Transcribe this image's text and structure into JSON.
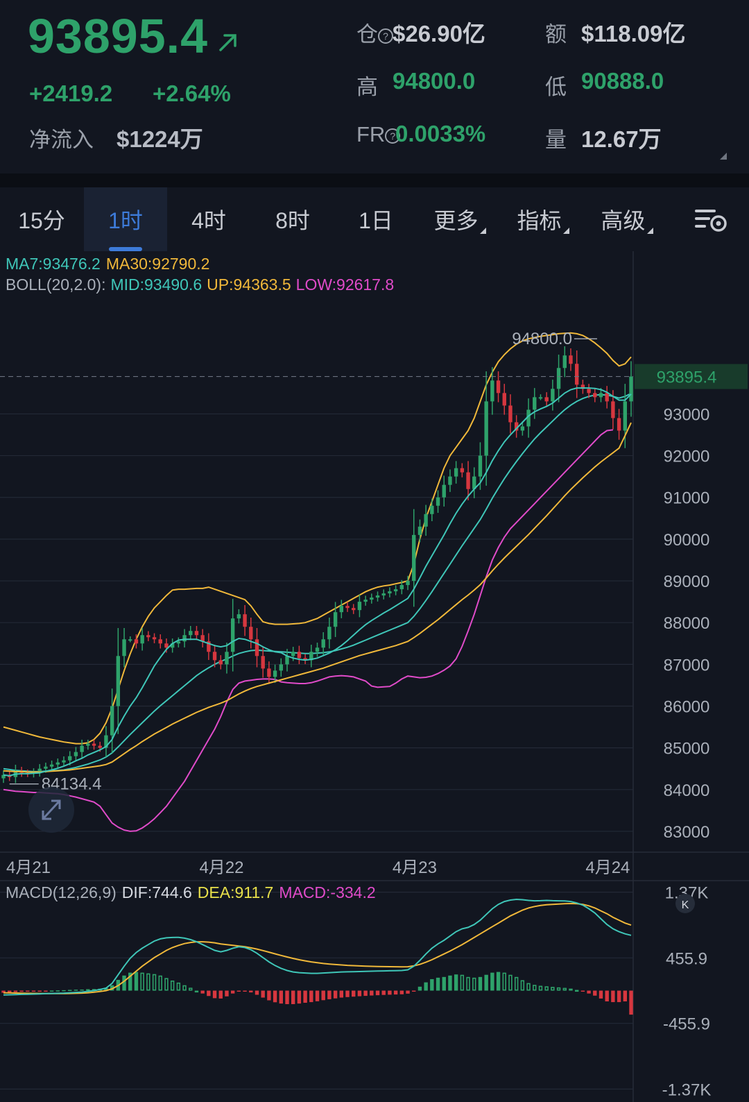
{
  "header": {
    "price": "93895.4",
    "change_abs": "+2419.2",
    "change_pct": "+2.64%",
    "netflow_label": "净流入",
    "netflow_value": "$1224万",
    "oi_label": "仓",
    "oi_value": "$26.90亿",
    "amount_label": "额",
    "amount_value": "$118.09亿",
    "high_label": "高",
    "high_value": "94800.0",
    "low_label": "低",
    "low_value": "90888.0",
    "fr_label": "FR",
    "fr_value": "0.0033%",
    "volume_label": "量",
    "volume_value": "12.67万",
    "info_glyph": "?"
  },
  "tabs": [
    {
      "label": "15分",
      "active": false
    },
    {
      "label": "1时",
      "active": true
    },
    {
      "label": "4时",
      "active": false
    },
    {
      "label": "8时",
      "active": false
    },
    {
      "label": "1日",
      "active": false
    },
    {
      "label": "更多",
      "active": false,
      "dropdown": true
    },
    {
      "label": "指标",
      "active": false,
      "dropdown": true
    },
    {
      "label": "高级",
      "active": false,
      "dropdown": true
    }
  ],
  "icons": {
    "price_arrow": "arrow-up-right-icon",
    "settings": "chart-settings-icon",
    "expand": "expand-icon",
    "collapse": "collapse-icon",
    "info": "question-circle-icon"
  },
  "colors": {
    "up": "#2ea26a",
    "down": "#d6373f",
    "ma7": "#3fc6b8",
    "ma30": "#f0b83a",
    "boll_mid": "#3fc6b8",
    "boll_up": "#f0b83a",
    "boll_low": "#e04bc9",
    "dif": "#3fc6b8",
    "dea": "#f0b83a",
    "accent": "#3d7bd9"
  },
  "chart_data": [
    {
      "type": "candlestick",
      "legend": {
        "ma7_text": "MA7:93476.2",
        "ma30_text": "MA30:92790.2",
        "boll_prefix": "BOLL(20,2.0):",
        "boll_mid_text": "MID:93490.6",
        "boll_up_text": "UP:94363.5",
        "boll_low_text": "LOW:92617.8"
      },
      "x_labels": [
        "4月21",
        "4月22",
        "4月23",
        "4月24"
      ],
      "y_ticks": [
        93000,
        92000,
        91000,
        90000,
        89000,
        88000,
        87000,
        86000,
        85000,
        84000,
        83000
      ],
      "ylim": [
        82600,
        95900
      ],
      "last_price_label": "93895.4",
      "max_label": "94800.0",
      "min_label": "84134.4",
      "grid": true,
      "closes": [
        84350,
        84300,
        84450,
        84400,
        84380,
        84420,
        84500,
        84550,
        84600,
        84650,
        84700,
        84800,
        84900,
        85050,
        85100,
        85050,
        85000,
        85300,
        86000,
        87200,
        87600,
        87600,
        87500,
        87700,
        87650,
        87600,
        87500,
        87400,
        87500,
        87550,
        87700,
        87800,
        87700,
        87550,
        87300,
        87100,
        87000,
        87300,
        88100,
        88200,
        87900,
        87600,
        87200,
        86900,
        86700,
        86850,
        87000,
        87200,
        87300,
        87150,
        87100,
        87300,
        87400,
        87600,
        87900,
        88250,
        88400,
        88350,
        88300,
        88500,
        88550,
        88600,
        88650,
        88700,
        88750,
        88800,
        88900,
        89000,
        90100,
        90300,
        90600,
        90800,
        91000,
        91300,
        91500,
        91700,
        91600,
        91200,
        91500,
        92000,
        93300,
        93800,
        93500,
        93200,
        92800,
        92600,
        92700,
        93100,
        93400,
        93400,
        93300,
        93600,
        94100,
        94400,
        94200,
        93700,
        93600,
        93500,
        93400,
        93500,
        93300,
        92900,
        92600,
        93300,
        93895.4
      ],
      "ma7": [
        84350,
        84330,
        84370,
        84380,
        84380,
        84390,
        84400,
        84440,
        84470,
        84510,
        84560,
        84620,
        84690,
        84750,
        84830,
        84890,
        84950,
        85030,
        85200,
        85500,
        85760,
        86000,
        86200,
        86440,
        86700,
        86960,
        87170,
        87360,
        87500,
        87580,
        87600,
        87600,
        87600,
        87550,
        87500,
        87450,
        87420,
        87450,
        87550,
        87620,
        87600,
        87550,
        87500,
        87420,
        87350,
        87300,
        87280,
        87200,
        87150,
        87120,
        87100,
        87120,
        87150,
        87210,
        87270,
        87350,
        87450,
        87570,
        87700,
        87830,
        87950,
        88050,
        88140,
        88230,
        88310,
        88400,
        88490,
        88580,
        88800,
        89070,
        89350,
        89600,
        89850,
        90100,
        90370,
        90620,
        90840,
        91030,
        91200,
        91350,
        91600,
        91880,
        92120,
        92330,
        92500,
        92650,
        92800,
        92950,
        93050,
        93120,
        93180,
        93260,
        93380,
        93500,
        93580,
        93620,
        93620,
        93620,
        93610,
        93580,
        93520,
        93420,
        93330,
        93330,
        93476.2
      ],
      "ma30": [
        84450,
        84440,
        84430,
        84430,
        84420,
        84420,
        84420,
        84430,
        84440,
        84450,
        84460,
        84470,
        84490,
        84510,
        84530,
        84550,
        84570,
        84600,
        84660,
        84760,
        84860,
        84960,
        85050,
        85150,
        85240,
        85330,
        85410,
        85490,
        85570,
        85640,
        85710,
        85780,
        85850,
        85910,
        85970,
        86020,
        86070,
        86130,
        86210,
        86290,
        86360,
        86420,
        86470,
        86510,
        86550,
        86590,
        86630,
        86670,
        86710,
        86750,
        86790,
        86830,
        86870,
        86910,
        86960,
        87010,
        87060,
        87110,
        87160,
        87210,
        87250,
        87290,
        87330,
        87370,
        87410,
        87450,
        87500,
        87550,
        87640,
        87740,
        87850,
        87960,
        88070,
        88190,
        88310,
        88430,
        88550,
        88660,
        88780,
        88910,
        89070,
        89240,
        89400,
        89550,
        89690,
        89830,
        89970,
        90110,
        90260,
        90410,
        90560,
        90720,
        90880,
        91040,
        91190,
        91330,
        91470,
        91600,
        91730,
        91850,
        91960,
        92070,
        92180,
        92480,
        92790.2
      ],
      "boll_mid": [
        84500,
        84480,
        84460,
        84450,
        84440,
        84430,
        84430,
        84440,
        84450,
        84460,
        84470,
        84500,
        84530,
        84570,
        84610,
        84660,
        84710,
        84780,
        84880,
        85020,
        85170,
        85320,
        85460,
        85600,
        85740,
        85880,
        86010,
        86130,
        86250,
        86370,
        86490,
        86610,
        86730,
        86830,
        86920,
        87000,
        87070,
        87130,
        87200,
        87260,
        87300,
        87330,
        87340,
        87330,
        87320,
        87310,
        87300,
        87290,
        87280,
        87270,
        87260,
        87260,
        87270,
        87280,
        87300,
        87330,
        87370,
        87410,
        87460,
        87520,
        87580,
        87640,
        87700,
        87760,
        87820,
        87880,
        87940,
        88000,
        88150,
        88330,
        88530,
        88740,
        88960,
        89180,
        89400,
        89620,
        89840,
        90050,
        90260,
        90470,
        90720,
        90980,
        91220,
        91450,
        91660,
        91860,
        92050,
        92230,
        92400,
        92550,
        92690,
        92830,
        92970,
        93100,
        93210,
        93300,
        93370,
        93420,
        93450,
        93460,
        93450,
        93420,
        93380,
        93420,
        93490.6
      ],
      "boll_up": [
        85500,
        85460,
        85420,
        85380,
        85340,
        85300,
        85260,
        85230,
        85200,
        85170,
        85140,
        85120,
        85100,
        85100,
        85120,
        85200,
        85350,
        85600,
        85950,
        86400,
        86850,
        87250,
        87600,
        87900,
        88150,
        88350,
        88500,
        88650,
        88780,
        88800,
        88800,
        88810,
        88820,
        88820,
        88850,
        88800,
        88750,
        88700,
        88650,
        88600,
        88550,
        88400,
        88200,
        88020,
        87980,
        87960,
        87960,
        87960,
        87970,
        87980,
        88000,
        88050,
        88100,
        88180,
        88260,
        88340,
        88420,
        88500,
        88580,
        88660,
        88740,
        88800,
        88850,
        88880,
        88900,
        88930,
        88960,
        89000,
        89400,
        90000,
        90500,
        90900,
        91300,
        91700,
        92000,
        92200,
        92400,
        92600,
        92900,
        93300,
        93700,
        94000,
        94250,
        94420,
        94560,
        94670,
        94750,
        94800,
        94830,
        94860,
        94880,
        94900,
        94920,
        94930,
        94940,
        94920,
        94880,
        94800,
        94700,
        94580,
        94450,
        94280,
        94150,
        94200,
        94363.5
      ],
      "boll_low": [
        84000,
        83980,
        83960,
        83950,
        83940,
        83930,
        83930,
        83920,
        83910,
        83900,
        83880,
        83850,
        83820,
        83780,
        83740,
        83700,
        83600,
        83400,
        83200,
        83100,
        83030,
        83000,
        83010,
        83080,
        83180,
        83300,
        83450,
        83600,
        83800,
        84000,
        84200,
        84450,
        84700,
        84950,
        85200,
        85450,
        85750,
        86100,
        86400,
        86550,
        86600,
        86620,
        86640,
        86650,
        86650,
        86640,
        86580,
        86560,
        86550,
        86540,
        86540,
        86560,
        86600,
        86650,
        86700,
        86720,
        86730,
        86720,
        86700,
        86650,
        86600,
        86480,
        86450,
        86460,
        86470,
        86550,
        86650,
        86720,
        86700,
        86680,
        86690,
        86720,
        86780,
        86860,
        86960,
        87130,
        87430,
        87800,
        88200,
        88650,
        89100,
        89500,
        89800,
        90050,
        90250,
        90400,
        90550,
        90700,
        90850,
        91000,
        91150,
        91300,
        91450,
        91600,
        91750,
        91900,
        92050,
        92200,
        92350,
        92500,
        92600,
        92617.8
      ]
    },
    {
      "type": "macd",
      "legend": {
        "name_text": "MACD(12,26,9)",
        "dif_text": "DIF:744.6",
        "dea_text": "DEA:911.7",
        "macd_text": "MACD:-334.2"
      },
      "y_labels": [
        "1.37K",
        "455.9",
        "-455.9",
        "-1.37K"
      ],
      "ylim": [
        -1550,
        1550
      ],
      "dif": [
        -60,
        -58,
        -55,
        -52,
        -50,
        -48,
        -45,
        -42,
        -40,
        -38,
        -35,
        -30,
        -25,
        -20,
        -10,
        0,
        15,
        35,
        100,
        220,
        340,
        450,
        530,
        590,
        640,
        690,
        720,
        735,
        740,
        742,
        730,
        710,
        680,
        640,
        600,
        560,
        540,
        560,
        590,
        610,
        600,
        570,
        520,
        460,
        400,
        350,
        310,
        280,
        260,
        250,
        245,
        240,
        240,
        245,
        250,
        255,
        260,
        262,
        264,
        266,
        268,
        270,
        272,
        274,
        276,
        278,
        280,
        290,
        340,
        420,
        510,
        590,
        650,
        700,
        760,
        820,
        860,
        880,
        920,
        980,
        1060,
        1140,
        1200,
        1240,
        1260,
        1270,
        1265,
        1255,
        1250,
        1252,
        1255,
        1252,
        1250,
        1248,
        1240,
        1220,
        1190,
        1140,
        1080,
        1000,
        920,
        860,
        820,
        790,
        770
      ],
      "dea": [
        -30,
        -32,
        -34,
        -36,
        -38,
        -39,
        -40,
        -41,
        -41,
        -41,
        -41,
        -40,
        -38,
        -35,
        -30,
        -22,
        -12,
        0,
        25,
        70,
        130,
        200,
        270,
        340,
        400,
        460,
        510,
        560,
        600,
        630,
        655,
        670,
        680,
        680,
        675,
        665,
        650,
        640,
        630,
        620,
        610,
        595,
        578,
        557,
        535,
        512,
        490,
        468,
        448,
        430,
        414,
        400,
        388,
        378,
        370,
        363,
        357,
        352,
        348,
        344,
        341,
        338,
        336,
        334,
        333,
        332,
        331,
        332,
        345,
        365,
        395,
        430,
        470,
        510,
        550,
        595,
        640,
        690,
        740,
        790,
        840,
        890,
        940,
        990,
        1040,
        1080,
        1120,
        1150,
        1170,
        1185,
        1195,
        1200,
        1205,
        1210,
        1212,
        1210,
        1200,
        1180,
        1150,
        1110,
        1070,
        1020,
        980,
        940,
        911.7
      ],
      "hist": [
        -30,
        -26,
        -21,
        -16,
        -12,
        -9,
        -5,
        -1,
        1,
        3,
        6,
        10,
        13,
        15,
        20,
        22,
        27,
        35,
        75,
        150,
        210,
        250,
        260,
        250,
        240,
        230,
        210,
        175,
        140,
        112,
        75,
        40,
        0,
        -40,
        -75,
        -105,
        -110,
        -80,
        -40,
        -10,
        -10,
        -25,
        -58,
        -97,
        -135,
        -162,
        -180,
        -188,
        -188,
        -180,
        -169,
        -160,
        -148,
        -133,
        -120,
        -108,
        -97,
        -90,
        -84,
        -78,
        -73,
        -68,
        -64,
        -60,
        -57,
        -54,
        -51,
        -42,
        -5,
        55,
        115,
        160,
        180,
        190,
        210,
        225,
        220,
        190,
        180,
        190,
        220,
        250,
        260,
        250,
        220,
        190,
        145,
        105,
        80,
        67,
        60,
        52,
        45,
        38,
        28,
        10,
        -10,
        -40,
        -70,
        -110,
        -150,
        -160,
        -160,
        -150,
        -334.2
      ]
    }
  ]
}
